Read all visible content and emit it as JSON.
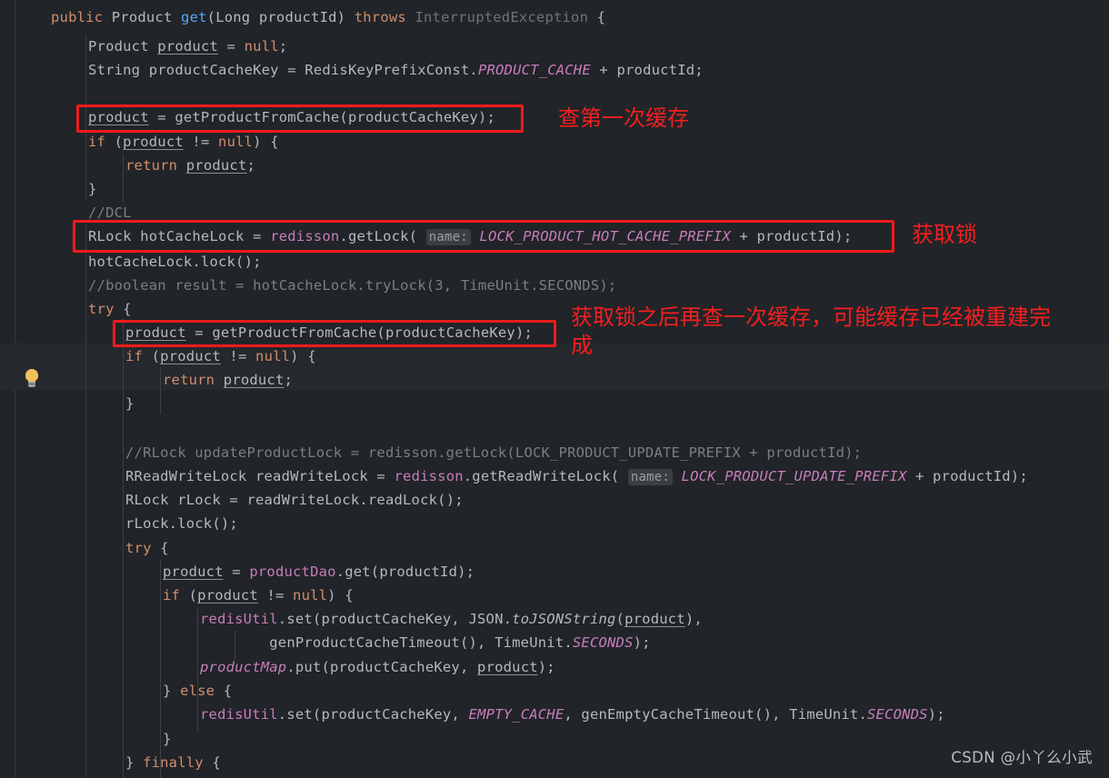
{
  "editor": {
    "theme_background": "#212428",
    "default_text_color": "#b4b9c0",
    "current_line_background": "#26292e",
    "annotation_color": "#f41f1f",
    "box_color": "#f01b1b",
    "language": "Java"
  },
  "gutter": {
    "bulb_icon": "lightbulb-icon"
  },
  "code_lines": [
    {
      "indent": 0,
      "text": "public Product get(Long productId) throws InterruptedException {"
    },
    {
      "indent": 1,
      "text": "Product product = null;"
    },
    {
      "indent": 1,
      "text": "String productCacheKey = RedisKeyPrefixConst.PRODUCT_CACHE + productId;"
    },
    {
      "indent": 1,
      "text": ""
    },
    {
      "indent": 1,
      "text": "product = getProductFromCache(productCacheKey);"
    },
    {
      "indent": 1,
      "text": "if (product != null) {"
    },
    {
      "indent": 2,
      "text": "return product;"
    },
    {
      "indent": 1,
      "text": "}"
    },
    {
      "indent": 1,
      "text": "//DCL"
    },
    {
      "indent": 1,
      "text": "RLock hotCacheLock = redisson.getLock( name: LOCK_PRODUCT_HOT_CACHE_PREFIX + productId);"
    },
    {
      "indent": 1,
      "text": "hotCacheLock.lock();"
    },
    {
      "indent": 1,
      "text": "//boolean result = hotCacheLock.tryLock(3, TimeUnit.SECONDS);"
    },
    {
      "indent": 1,
      "text": "try {"
    },
    {
      "indent": 2,
      "text": "product = getProductFromCache(productCacheKey);"
    },
    {
      "indent": 2,
      "text": "if (product != null) {"
    },
    {
      "indent": 3,
      "text": "return product;"
    },
    {
      "indent": 2,
      "text": "}"
    },
    {
      "indent": 2,
      "text": ""
    },
    {
      "indent": 2,
      "text": "//RLock updateProductLock = redisson.getLock(LOCK_PRODUCT_UPDATE_PREFIX + productId);"
    },
    {
      "indent": 2,
      "text": "RReadWriteLock readWriteLock = redisson.getReadWriteLock( name: LOCK_PRODUCT_UPDATE_PREFIX + productId);"
    },
    {
      "indent": 2,
      "text": "RLock rLock = readWriteLock.readLock();"
    },
    {
      "indent": 2,
      "text": "rLock.lock();"
    },
    {
      "indent": 2,
      "text": "try {"
    },
    {
      "indent": 3,
      "text": "product = productDao.get(productId);"
    },
    {
      "indent": 3,
      "text": "if (product != null) {"
    },
    {
      "indent": 4,
      "text": "redisUtil.set(productCacheKey, JSON.toJSONString(product),"
    },
    {
      "indent": 5,
      "text": "    genProductCacheTimeout(), TimeUnit.SECONDS);"
    },
    {
      "indent": 4,
      "text": "productMap.put(productCacheKey, product);"
    },
    {
      "indent": 3,
      "text": "} else {"
    },
    {
      "indent": 4,
      "text": "redisUtil.set(productCacheKey, EMPTY_CACHE, genEmptyCacheTimeout(), TimeUnit.SECONDS);"
    },
    {
      "indent": 3,
      "text": "}"
    },
    {
      "indent": 2,
      "text": "} finally {"
    }
  ],
  "annotations": [
    {
      "name": "annotation-first-cache-lookup",
      "text": "查第一次缓存"
    },
    {
      "name": "annotation-acquire-lock",
      "text": "获取锁"
    },
    {
      "name": "annotation-recheck-cache",
      "text": "获取锁之后再查一次缓存，可能缓存已经被重建完\n成"
    }
  ],
  "watermark": {
    "text": "CSDN @小丫么小武"
  }
}
